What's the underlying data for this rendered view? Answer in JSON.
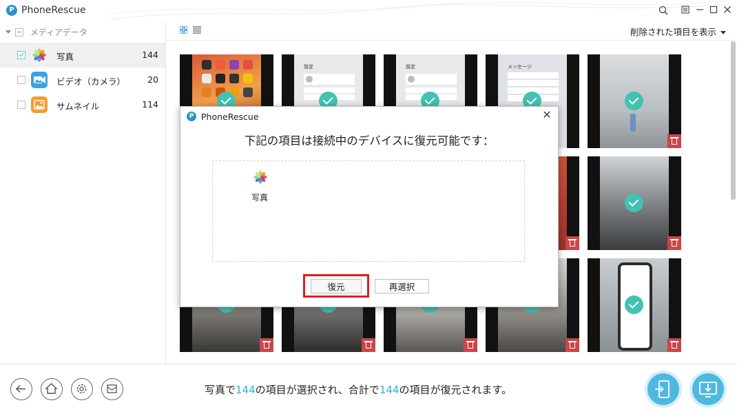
{
  "app": {
    "title": "PhoneRescue"
  },
  "sidebar": {
    "header": "メディアデータ",
    "items": [
      {
        "label": "写真",
        "count": "144",
        "icon": "photos-icon"
      },
      {
        "label": "ビデオ（カメラ）",
        "count": "20",
        "icon": "video-icon"
      },
      {
        "label": "サムネイル",
        "count": "114",
        "icon": "thumbnail-icon"
      }
    ]
  },
  "toolbar": {
    "filter_label": "削除された項目を表示"
  },
  "dialog": {
    "title": "PhoneRescue",
    "message": "下記の項目は接続中のデバイスに復元可能です：",
    "item_label": "写真",
    "restore_label": "復元",
    "reselect_label": "再選択"
  },
  "status": {
    "p1": "写真で",
    "n1": "144",
    "p2": "の項目が選択され、合計で",
    "n2": "144",
    "p3": "の項目が復元されます。"
  },
  "colors": {
    "accent": "#43c2b3",
    "highlight_text": "#2fb3c7",
    "trash": "#c9464a",
    "restore_outline": "#e41a1a",
    "action_blue": "#4fb8e0"
  }
}
